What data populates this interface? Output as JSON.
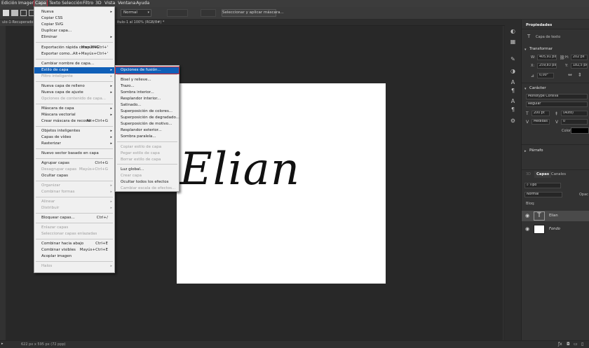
{
  "menubar": {
    "items": [
      "Edición",
      "Imagen",
      "Capa",
      "Texto",
      "Selección",
      "Filtro",
      "3D",
      "Vista",
      "Ventana",
      "Ayuda"
    ]
  },
  "options": {
    "mode_value": "Normal",
    "mask_button": "Seleccionar y aplicar máscara..."
  },
  "tabs": {
    "doc_left": "ulo-1-Recuperado-",
    "doc_right": "ítulo-1 al 100% (RGB/8#) *"
  },
  "document": {
    "text": "Elian"
  },
  "status": {
    "text": "622 px x 595 px (72 ppp)"
  },
  "properties": {
    "tab_title": "Propiedades",
    "layer_type": "Capa de texto",
    "transform_header": "Transformar",
    "w_value": "405,91 px",
    "h_value": "202 px",
    "x_value": "259,83 px",
    "y_value": "182,5 px",
    "angle_value": "0,00°",
    "character_header": "Carácter",
    "font_family": "Monotype Corsiva",
    "font_style": "Regular",
    "font_size": "200 pt",
    "leading": "(Auto)",
    "tracking": "Medidas",
    "tracking_value": "0",
    "color_label": "Color",
    "paragraph_header": "Párrafo"
  },
  "layers_panel": {
    "tab_layers": "Capas",
    "tab_channels": "Canales",
    "filter_label": "Tipo",
    "blend_mode": "Normal",
    "opacity_label": "Opac",
    "lock_label": "Bloq:",
    "layers": [
      {
        "name": "Elian",
        "kind": "text"
      },
      {
        "name": "Fondo",
        "kind": "image"
      }
    ]
  },
  "capa_menu": {
    "items": [
      {
        "label": "Nueva",
        "shortcut": "",
        "arrow": true,
        "disabled": false
      },
      {
        "label": "Copiar CSS",
        "shortcut": "",
        "arrow": false,
        "disabled": false
      },
      {
        "label": "Copiar SVG",
        "shortcut": "",
        "arrow": false,
        "disabled": false
      },
      {
        "label": "Duplicar capa...",
        "shortcut": "",
        "arrow": false,
        "disabled": false
      },
      {
        "label": "Eliminar",
        "shortcut": "",
        "arrow": true,
        "disabled": false
      },
      {
        "label": "Exportación rápida como PNG",
        "shortcut": "Mayús+Ctrl+'",
        "arrow": false,
        "disabled": false
      },
      {
        "label": "Exportar como...",
        "shortcut": "Alt+Mayús+Ctrl+'",
        "arrow": false,
        "disabled": false
      },
      {
        "label": "Cambiar nombre de capa...",
        "shortcut": "",
        "arrow": false,
        "disabled": false
      },
      {
        "label": "Estilo de capa",
        "shortcut": "",
        "arrow": true,
        "disabled": false,
        "highlighted": true
      },
      {
        "label": "Filtro inteligente",
        "shortcut": "",
        "arrow": true,
        "disabled": true
      },
      {
        "label": "Nueva capa de relleno",
        "shortcut": "",
        "arrow": true,
        "disabled": false
      },
      {
        "label": "Nueva capa de ajuste",
        "shortcut": "",
        "arrow": true,
        "disabled": false
      },
      {
        "label": "Opciones de contenido de capa...",
        "shortcut": "",
        "arrow": false,
        "disabled": true
      },
      {
        "label": "Máscara de capa",
        "shortcut": "",
        "arrow": true,
        "disabled": false
      },
      {
        "label": "Máscara vectorial",
        "shortcut": "",
        "arrow": true,
        "disabled": false
      },
      {
        "label": "Crear máscara de recorte",
        "shortcut": "Alt+Ctrl+G",
        "arrow": false,
        "disabled": false
      },
      {
        "label": "Objetos inteligentes",
        "shortcut": "",
        "arrow": true,
        "disabled": false
      },
      {
        "label": "Capas de vídeo",
        "shortcut": "",
        "arrow": true,
        "disabled": false
      },
      {
        "label": "Rasterizar",
        "shortcut": "",
        "arrow": true,
        "disabled": false
      },
      {
        "label": "Nuevo sector basado en capa",
        "shortcut": "",
        "arrow": false,
        "disabled": false
      },
      {
        "label": "Agrupar capas",
        "shortcut": "Ctrl+G",
        "arrow": false,
        "disabled": false
      },
      {
        "label": "Desagrupar capas",
        "shortcut": "Mayús+Ctrl+G",
        "arrow": false,
        "disabled": true
      },
      {
        "label": "Ocultar capas",
        "shortcut": "",
        "arrow": false,
        "disabled": false
      },
      {
        "label": "Organizar",
        "shortcut": "",
        "arrow": true,
        "disabled": true
      },
      {
        "label": "Combinar formas",
        "shortcut": "",
        "arrow": true,
        "disabled": true
      },
      {
        "label": "Alinear",
        "shortcut": "",
        "arrow": true,
        "disabled": true
      },
      {
        "label": "Distribuir",
        "shortcut": "",
        "arrow": true,
        "disabled": true
      },
      {
        "label": "Bloquear capas...",
        "shortcut": "Ctrl+/",
        "arrow": false,
        "disabled": false
      },
      {
        "label": "Enlazar capas",
        "shortcut": "",
        "arrow": false,
        "disabled": true
      },
      {
        "label": "Seleccionar capas enlazadas",
        "shortcut": "",
        "arrow": false,
        "disabled": true
      },
      {
        "label": "Combinar hacia abajo",
        "shortcut": "Ctrl+E",
        "arrow": false,
        "disabled": false
      },
      {
        "label": "Combinar visibles",
        "shortcut": "Mayús+Ctrl+E",
        "arrow": false,
        "disabled": false
      },
      {
        "label": "Acoplar imagen",
        "shortcut": "",
        "arrow": false,
        "disabled": false
      },
      {
        "label": "Halos",
        "shortcut": "",
        "arrow": true,
        "disabled": true
      }
    ]
  },
  "sub_menu": {
    "items": [
      {
        "label": "Opciones de fusión...",
        "disabled": false,
        "highlighted": true
      },
      {
        "label": "Bisel y relieve...",
        "disabled": false
      },
      {
        "label": "Trazo...",
        "disabled": false
      },
      {
        "label": "Sombra interior...",
        "disabled": false
      },
      {
        "label": "Resplandor interior...",
        "disabled": false
      },
      {
        "label": "Satinado...",
        "disabled": false
      },
      {
        "label": "Superposición de colores...",
        "disabled": false
      },
      {
        "label": "Superposición de degradado...",
        "disabled": false
      },
      {
        "label": "Superposición de motivo...",
        "disabled": false
      },
      {
        "label": "Resplandor exterior...",
        "disabled": false
      },
      {
        "label": "Sombra paralela...",
        "disabled": false
      },
      {
        "label": "Copiar estilo de capa",
        "disabled": true
      },
      {
        "label": "Pegar estilo de capa",
        "disabled": true
      },
      {
        "label": "Borrar estilo de capa",
        "disabled": true
      },
      {
        "label": "Luz global...",
        "disabled": false
      },
      {
        "label": "Crear capa",
        "disabled": true
      },
      {
        "label": "Ocultar todos los efectos",
        "disabled": false
      },
      {
        "label": "Cambiar escala de efectos...",
        "disabled": true
      }
    ]
  }
}
